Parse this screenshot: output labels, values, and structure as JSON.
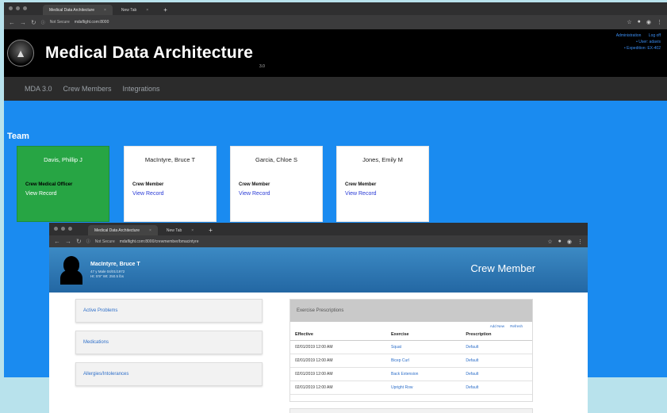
{
  "back_window": {
    "tabs": [
      {
        "label": "Medical Data Architecture",
        "close": "×"
      },
      {
        "label": "New Tab",
        "close": "×"
      }
    ],
    "new_tab": "+",
    "url_prefix": "Not Secure",
    "url": "mdaflight.com:8000",
    "app": {
      "title": "Medical Data Architecture",
      "version": "3.0",
      "user_links": {
        "administration": "Administration",
        "logoff": "Log off",
        "user": "• User: adavis",
        "expedition": "• Expedition: EX-402"
      },
      "nav": [
        "MDA 3.0",
        "Crew Members",
        "Integrations"
      ],
      "team_label": "Team",
      "cards": [
        {
          "name": "Davis, Phillip J",
          "role": "Crew Medical Officer",
          "link": "View Record"
        },
        {
          "name": "MacIntyre, Bruce T",
          "role": "Crew Member",
          "link": "View Record"
        },
        {
          "name": "Garcia, Chloe S",
          "role": "Crew Member",
          "link": "View Record"
        },
        {
          "name": "Jones, Emily M",
          "role": "Crew Member",
          "link": "View Record"
        }
      ]
    }
  },
  "front_window": {
    "tabs": [
      {
        "label": "Medical Data Architecture",
        "close": "×"
      },
      {
        "label": "New Tab",
        "close": "×"
      }
    ],
    "new_tab": "+",
    "url_prefix": "Not Secure",
    "url": "mdaflight.com:8000/crewmember/bmacintyre",
    "crew": {
      "name": "MacIntyre, Bruce T",
      "line1": "47 y Male 04/01/1972",
      "line2": "Ht: 5'9\" Wt: 250.5 lbs",
      "header_title": "Crew Member"
    },
    "panels": [
      "Active Problems",
      "Medications",
      "Allergies/Intolerances"
    ],
    "exercise": {
      "heading": "Exercise Prescriptions",
      "actions": [
        "Add New",
        "Refresh"
      ],
      "columns": [
        "Effective",
        "Exercise",
        "Prescription"
      ],
      "rows": [
        {
          "effective": "02/01/2019 12:00 AM",
          "exercise": "Squat",
          "prescription": "Default"
        },
        {
          "effective": "02/01/2019 12:00 AM",
          "exercise": "Bicep Curl",
          "prescription": "Default"
        },
        {
          "effective": "02/01/2019 12:00 AM",
          "exercise": "Back Extension",
          "prescription": "Default"
        },
        {
          "effective": "02/01/2019 12:00 AM",
          "exercise": "Upright Row",
          "prescription": "Default"
        }
      ]
    }
  },
  "colors": {
    "brand_blue": "#1a8bf0",
    "header_black": "#000000",
    "officer_green": "#27a544",
    "link_blue": "#2e6fc9"
  }
}
